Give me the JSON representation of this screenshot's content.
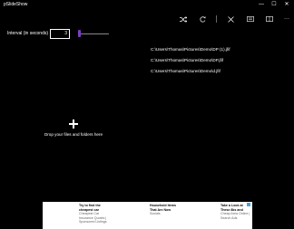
{
  "window": {
    "title": "pSlideShow",
    "minimize_glyph": "—",
    "maximize_glyph": "☐",
    "close_glyph": "✕"
  },
  "toolbar": {
    "buttons": [
      {
        "name": "shuffle-icon"
      },
      {
        "name": "refresh-icon"
      },
      {
        "name": "clear-icon"
      },
      {
        "name": "slideshow-icon"
      },
      {
        "name": "fullscreen-icon"
      },
      {
        "name": "more-icon",
        "glyph": "···"
      }
    ]
  },
  "interval": {
    "label": "Interval (in seconds)",
    "value": "3",
    "slider_fraction": 0.03
  },
  "files": {
    "paths": [
      "C:\\Users\\Thomas\\Pictures\\Demo\\DP (1).jfif",
      "C:\\Users\\Thomas\\Pictures\\Demo\\DP.jfif",
      "C:\\Users\\Thomas\\Pictures\\Demo\\d.jfif"
    ]
  },
  "drop_zone": {
    "text": "Drop your files and folders here"
  },
  "ad": {
    "col1": [
      "Try to find the",
      "cheapest car",
      "Cheapest Car",
      "Insurance Quotes |",
      "Sponsored Listings"
    ],
    "col2": [
      "Household Items",
      "That Are Now",
      "Socials"
    ],
    "col3": [
      "Take a Look at",
      "These 8ks and",
      "Cheap Area Online |",
      "Search Ads"
    ]
  },
  "colors": {
    "background": "#000000",
    "accent": "#7b3fc4"
  }
}
